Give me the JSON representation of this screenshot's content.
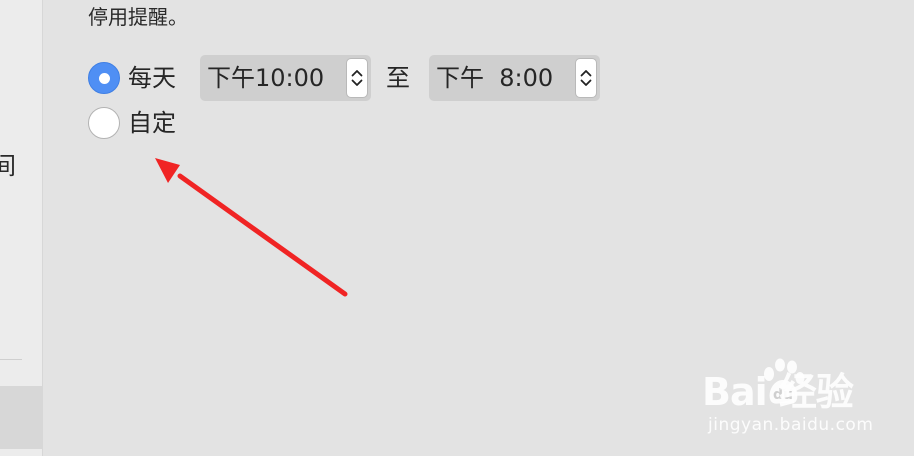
{
  "sidebar": {
    "partial_text": "间"
  },
  "heading": "停用提醒。",
  "schedule": {
    "daily_label": "每天",
    "custom_label": "自定",
    "daily_checked": true,
    "custom_checked": false,
    "start_time": "下午10:00",
    "to_label": "至",
    "end_time": "下午  8:00"
  },
  "colors": {
    "accent": "#4f8ff4",
    "annotation_arrow": "#f02424",
    "background": "#e3e3e3"
  },
  "watermark": {
    "brand_text": "Bai  经验",
    "url": "jingyan.baidu.com"
  }
}
